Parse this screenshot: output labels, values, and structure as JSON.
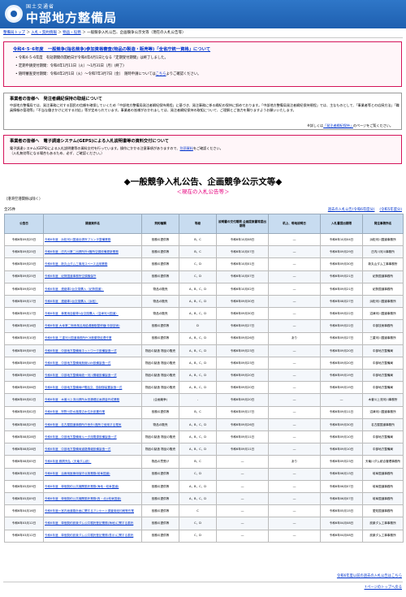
{
  "header": {
    "sub": "国土交通省",
    "main": "中部地方整備局"
  },
  "crumbs": [
    {
      "label": "整備局トップ"
    },
    {
      "label": "入札・契約情報"
    },
    {
      "label": "物品・役務"
    },
    {
      "label": "一般競争入札公告、企画競争公示文等（現在の入札公告等）"
    }
  ],
  "crumbs_sep": "＞",
  "notice1": {
    "title": "令和4･5･6年度　一般競争(指名競争)参加資格審査(物品の製造・販売等)「全省庁統一資格」について",
    "items": [
      "令和4･5･6年度　有効期間の開始日が令和4年4月1日となる「定期受付期間」は終了しました。",
      "定期申請受付期間：令和4年1月11日（火）～1月31日（月）(終了)",
      "随時審査受付期間：令和4年2月1日（火）～令和7年3月7日（金）　随時申請については"
    ],
    "link": "こちら",
    "link_suffix": "よりご確認ください。"
  },
  "notice2": {
    "heading": "事業者の皆様へ　発注者綱紀保持の取組について",
    "body": "中部地方整備局では、発注事務に対する国民の信頼を確保していくため「中部地方整備局発注者綱紀保持規程」に基づき、発注事務に係る綱紀の保持に努めております。「中部地方整備局発注者綱紀保持規程」では、主なものとして、「事業者等との応接方法」「職員情報の管理等」「不当な働きかけに対する対応」等が定められています。事業者の皆様がおかれましては、発注者綱紀保持の取組について、ご理解とご協力を賜りますようお願いいたします。",
    "prefix": "※詳しくは",
    "link": "「発注者綱紀保持」",
    "suffix": "のページをご覧ください。"
  },
  "notice3": {
    "heading": "事業者の皆様へ　電子調達システム(GEPS)による入札説明書等の資料交付について",
    "line1a": "電子調達システム(GEPS)による入札説明書等の資料交付を行っています。操作にかかる注意事項がありますので、",
    "link": "別添資料",
    "line1b": "をご確認ください。",
    "line2": "（入札無効等になる場合もあるため、必ず、ご確認ください。）"
  },
  "page_title": "◆一般競争入札公告、企画競争公示文等◆",
  "page_subtitle": "＜現在の入札公告等＞",
  "exclusion": "（港湾空港関係は除く）",
  "count": "全25件",
  "past_link": "過去の入札公告(令和6年度分)",
  "other_link": "(令和5年度分)",
  "columns": [
    "公告日",
    "調達案件名",
    "契約種類",
    "等級",
    "説明書の交付期限 企画提案書等提出期限",
    "机上、現地説明日",
    "入札書提出期限",
    "発注事務所名"
  ],
  "rows": [
    {
      "date": "令和6年09月25日",
      "name": "令和6年度　浜松河川国道出張所プリンタ整備業務",
      "type": "役務の提供等",
      "grade": "B，C",
      "exp": "令和6年10月08日",
      "desk": "―",
      "deadline": "令和6年10月04日",
      "office": "浜松河川国道事務所"
    },
    {
      "date": "令和6年09月25日",
      "name": "令和6年度　庄内川第二出張所外4箇所空調設備更新業務",
      "type": "役務の提供等",
      "grade": "B，C",
      "exp": "令和6年10月07日",
      "desk": "―",
      "deadline": "令和6年09月29日",
      "office": "庄内川河川事務所"
    },
    {
      "date": "令和6年09月25日",
      "name": "令和6年度　新丸山ダム工事用スペース活用業務",
      "type": "役務の提供等",
      "grade": "C，D",
      "exp": "令和6年10月01日",
      "desk": "―",
      "deadline": "令和6年09月30日",
      "office": "新丸山ダム工事事務所"
    },
    {
      "date": "令和6年09月25日",
      "name": "令和6年度　紀勢国道事務所空調機保守",
      "type": "役務の提供等",
      "grade": "C，D",
      "exp": "令和6年10月07日",
      "desk": "―",
      "deadline": "令和6年09月21日",
      "office": "紀勢国道事務所"
    },
    {
      "date": "令和6年09月25日",
      "name": "令和6年度　連絡車2台交換購入（紀勢国道）",
      "type": "物品の販売",
      "grade": "A，B，C，D",
      "exp": "令和6年10月02日",
      "desk": "―",
      "deadline": "令和6年09月21日",
      "office": "紀勢国道事務所"
    },
    {
      "date": "令和6年09月17日",
      "name": "令和6年度　連絡車1台交換購入（浜松）",
      "type": "物品の販売",
      "grade": "A，B，C，D",
      "exp": "令和6年09月30日",
      "desk": "―",
      "deadline": "令和6年08月27日",
      "office": "浜松河川国道事務所"
    },
    {
      "date": "令和6年09月17日",
      "name": "令和6年度　事業用自動車1台交換購入（沼津河川国道）",
      "type": "物品の販売",
      "grade": "A，B，C，D",
      "exp": "令和6年09月30日",
      "desk": "―",
      "deadline": "令和6年09月22日",
      "office": "沼津河川国道事務所"
    },
    {
      "date": "令和6年09月16日",
      "name": "令和6年度 大幸第二宿舎風呂用給湯器取替修繕(中部技術)",
      "type": "役務の提供等",
      "grade": "D",
      "exp": "令和6年09月27日",
      "desk": "―",
      "deadline": "令和6年09月22日",
      "office": "中部技術事務所"
    },
    {
      "date": "令和6年09月10日",
      "name": "令和6年度 三重河川国道事務所PCB廃棄物処理作業",
      "type": "役務の提供等",
      "grade": "A，B，C，D",
      "exp": "令和6年09月26日",
      "desk": "あり",
      "deadline": "令和6年09月27日",
      "office": "三重河川国道事務所"
    },
    {
      "date": "令和6年09月09日",
      "name": "令和6年度　中部地方整備局ネットワーク設備製造一式",
      "type": "物品の製造 物品の販売",
      "grade": "A，B，C，D",
      "exp": "令和6年09月23日",
      "desk": "―",
      "deadline": "令和6年09月20日",
      "office": "中部地方整備局"
    },
    {
      "date": "令和6年09月09日",
      "name": "令和6年度　中部地方整備局無線LAN設備製造一式",
      "type": "物品の製造 物品の販売",
      "grade": "A，B，C，D",
      "exp": "令和6年09月23日",
      "desk": "―",
      "deadline": "令和6年09月20日",
      "office": "中部地方整備局"
    },
    {
      "date": "令和6年09月06日",
      "name": "令和6年度　中部地方整備局統一河川情報設備製造一式",
      "type": "物品の製造 物品の販売",
      "grade": "A，B，C，D",
      "exp": "令和6年09月20日",
      "desk": "―",
      "deadline": "令和6年09月19日",
      "office": "中部地方整備局"
    },
    {
      "date": "令和6年09月06日",
      "name": "令和6年度　中部地方整備局IP電話交、換制御装置製造一式",
      "type": "物品の製造 物品の販売",
      "grade": "A，B，C，D",
      "exp": "令和6年09月20日",
      "desk": "―",
      "deadline": "令和6年09月19日",
      "office": "中部地方整備局"
    },
    {
      "date": "令和6年09月02日",
      "name": "令和6年度　木曽川上流出張所太田漏堤区画測量作成業務",
      "type": "(企画競争)",
      "grade": "-",
      "exp": "令和6年09月20日",
      "desk": "―",
      "deadline": "―",
      "office": "木曽川上流河川事務所"
    },
    {
      "date": "令和6年09月02日",
      "name": "令和6年度　狩野川防水路周辺水位計設置作業",
      "type": "役務の提供等",
      "grade": "B，C",
      "exp": "令和6年09月17日",
      "desk": "―",
      "deadline": "令和6年09月11日",
      "office": "沼津河川国道事務所"
    },
    {
      "date": "令和6年08月29日",
      "name": "令和6年度　名古屋国道事務所庁舎外1箇所で使用する電気",
      "type": "物品の販売",
      "grade": "A，B，C，D",
      "exp": "令和6年09月26日",
      "desk": "―",
      "deadline": "令和6年09月30日",
      "office": "名古屋国道事務所"
    },
    {
      "date": "令和6年08月28日",
      "name": "令和6年度　中部地方整備局ルータ用電源設備製造一式",
      "type": "物品の製造 物品の販売",
      "grade": "A，B，C，D",
      "exp": "令和6年09月11日",
      "desk": "―",
      "deadline": "令和6年09月10日",
      "office": "中部地方整備局"
    },
    {
      "date": "令和6年08月28日",
      "name": "令和6年度　中部地方整備局道路情報設備製造一式",
      "type": "物品の製造 物品の販売",
      "grade": "A，B，C，D",
      "exp": "令和6年09月11日",
      "desk": "―",
      "deadline": "令和6年09月10日",
      "office": "中部地方整備局"
    },
    {
      "date": "令和6年08月05日",
      "name": "令和6年度 鋼屑売払（天竜ダム統）",
      "type": "物品の買受け",
      "grade": "B，C",
      "exp": "―",
      "desk": "あり",
      "deadline": "令和6年09月23日",
      "office": "天竜川ダム統合管理事務所"
    },
    {
      "date": "令和6年05月15日",
      "name": "令和6年度　治療用医療用保守点検業務(岐阜国道)",
      "type": "役務の提供等",
      "grade": "C，D",
      "exp": "―",
      "desk": "―",
      "deadline": "令和6年06月13日",
      "office": "岐阜国道事務所"
    },
    {
      "date": "令和6年05月09日",
      "name": "令和6年度　単価契約公共機関委託業務(海地・岐阜国道)",
      "type": "役務の提供等",
      "grade": "A，B，C，D",
      "exp": "―",
      "desk": "―",
      "deadline": "令和6年06月07日",
      "office": "岐阜国道事務所"
    },
    {
      "date": "令和6年05月09日",
      "name": "令和6年度　単価契約公共機関委託業務(西・北)(岐阜国道)",
      "type": "役務の提供等",
      "grade": "A，B，C，D",
      "exp": "―",
      "desk": "―",
      "deadline": "令和6年06月07日",
      "office": "岐阜国道事務所"
    },
    {
      "date": "令和6年04月16日",
      "name": "令和6年度～宮内坂道路計画に関するアンケート調査用紙印刷等作業",
      "type": "役務の提供等",
      "grade": "C",
      "exp": "―",
      "desk": "―",
      "deadline": "令和6年05月15日",
      "office": "愛知国道事務所"
    },
    {
      "date": "令和6年03月12日",
      "name": "令和6年度　単価契約設楽ダム公共嘱託登記業務(海地)に関する委託",
      "type": "役務の提供等",
      "grade": "C，D",
      "exp": "―",
      "desk": "―",
      "deadline": "令和6年04月08日",
      "office": "設楽ダム工事事務所"
    },
    {
      "date": "令和6年03月12日",
      "name": "令和6年度　単価契約設楽ダム公共嘱託登記業務(表示)に関する委託",
      "type": "役務の提供等",
      "grade": "C，D",
      "exp": "―",
      "desk": "―",
      "deadline": "令和6年04月08日",
      "office": "設楽ダム工事事務所"
    }
  ],
  "footer": {
    "past_all": "令和6年度以前の過去の入札公告はこちら",
    "to_top": "↑ページのトップへ戻る"
  }
}
